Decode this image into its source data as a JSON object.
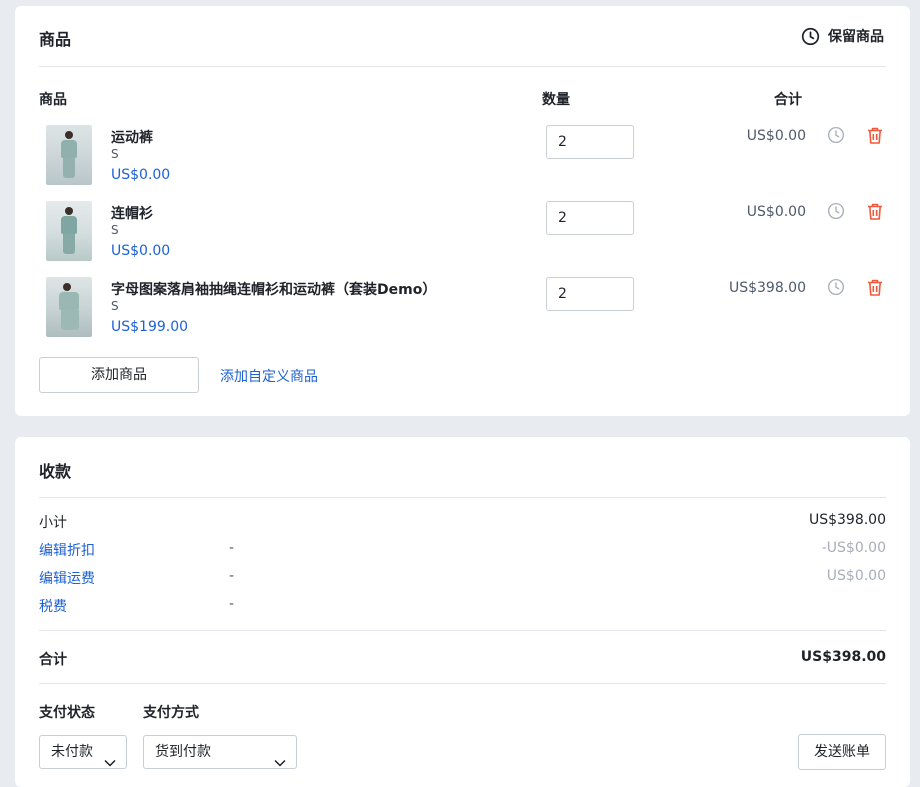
{
  "products_card": {
    "title": "商品",
    "hold_label": "保留商品",
    "columns": {
      "product": "商品",
      "quantity": "数量",
      "total": "合计"
    },
    "items": [
      {
        "name": "运动裤",
        "variant": "S",
        "price": "US$0.00",
        "quantity": "2",
        "total": "US$0.00"
      },
      {
        "name": "连帽衫",
        "variant": "S",
        "price": "US$0.00",
        "quantity": "2",
        "total": "US$0.00"
      },
      {
        "name": "字母图案落肩袖抽绳连帽衫和运动裤（套装Demo）",
        "variant": "S",
        "price": "US$199.00",
        "quantity": "2",
        "total": "US$398.00"
      }
    ],
    "add_product_label": "添加商品",
    "add_custom_label": "添加自定义商品"
  },
  "payment_card": {
    "title": "收款",
    "subtotal_label": "小计",
    "subtotal_value": "US$398.00",
    "discount_label": "编辑折扣",
    "discount_detail": "-",
    "discount_value": "-US$0.00",
    "shipping_label": "编辑运费",
    "shipping_detail": "-",
    "shipping_value": "US$0.00",
    "tax_label": "税费",
    "tax_detail": "-",
    "total_label": "合计",
    "total_value": "US$398.00",
    "payment_status_label": "支付状态",
    "payment_method_label": "支付方式",
    "payment_status_value": "未付款",
    "payment_method_value": "货到付款",
    "send_invoice_label": "发送账单"
  },
  "colors": {
    "accent": "#1d61d4",
    "danger": "#f05a3c",
    "muted_icon": "#a9aeb8"
  }
}
